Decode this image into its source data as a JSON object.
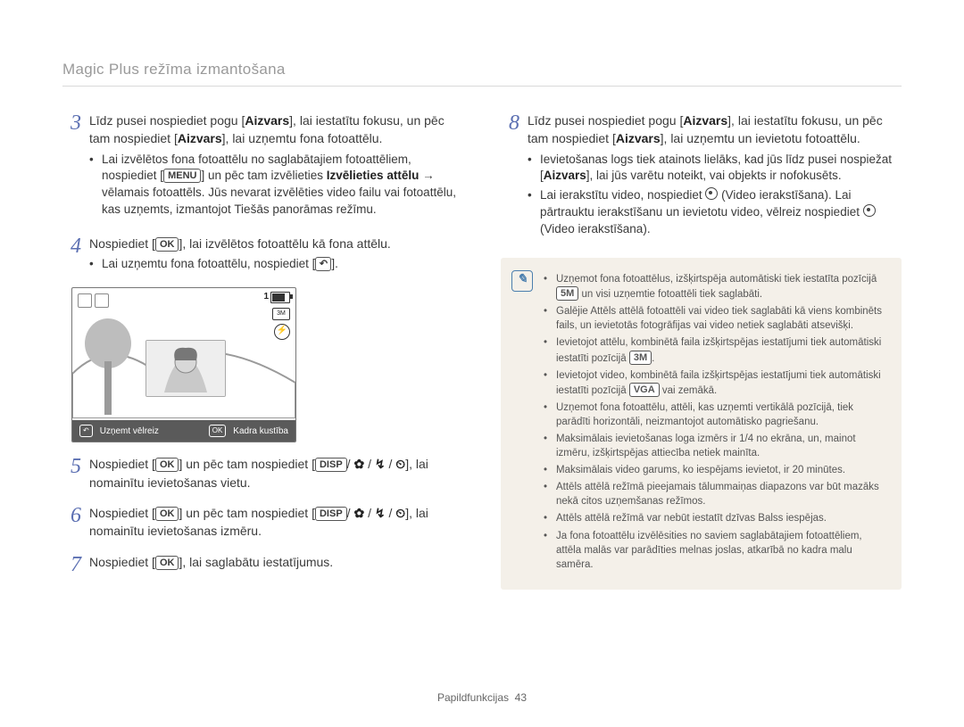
{
  "page_title": "Magic Plus režīma izmantošana",
  "footer": {
    "section": "Papildfunkcijas",
    "page": "43"
  },
  "left": {
    "steps": [
      {
        "n": "3",
        "text": [
          "Līdz pusei nospiediet pogu [<b>Aizvars</b>], lai iestatītu fokusu, un pēc tam nospiediet [<b>Aizvars</b>], lai uzņemtu fona fotoattēlu."
        ],
        "bullets": [
          "Lai izvēlētos fona fotoattēlu no saglabātajiem fotoattēliem, nospiediet [<span class='key'>MENU</span>] un pēc tam izvēlieties <b>Izvēlieties attēlu</b> → vēlamais fotoattēls. Jūs nevarat izvēlēties video failu vai fotoattēlu, kas uzņemts, izmantojot Tiešās panorāmas režīmu."
        ]
      },
      {
        "n": "4",
        "text": [
          "Nospiediet [<span class='key'>OK</span>], lai izvēlētos fotoattēlu kā fona attēlu."
        ],
        "bullets": [
          "Lai uzņemtu fona fotoattēlu, nospiediet [<span class='key icon'>↶</span>]."
        ],
        "has_screenshot": true
      },
      {
        "n": "5",
        "text": [
          "Nospiediet [<span class='key'>OK</span>] un pēc tam nospiediet [<span class='key'>DISP</span>/ <b>✿</b> / <b>↯</b> / <b>⏲</b>], lai nomainītu ievietošanas vietu."
        ]
      },
      {
        "n": "6",
        "text": [
          "Nospiediet [<span class='key'>OK</span>] un pēc tam nospiediet [<span class='key'>DISP</span>/ <b>✿</b> / <b>↯</b> / <b>⏲</b>], lai nomainītu ievietošanas izmēru."
        ]
      },
      {
        "n": "7",
        "text": [
          "Nospiediet [<span class='key'>OK</span>], lai saglabātu iestatījumus."
        ]
      }
    ],
    "screenshot": {
      "top_index": "1",
      "bottom_left": "Uzņemt vēlreiz",
      "bottom_right": "Kadra kustība"
    }
  },
  "right": {
    "steps": [
      {
        "n": "8",
        "text": [
          "Līdz pusei nospiediet pogu [<b>Aizvars</b>], lai iestatītu fokusu, un pēc tam nospiediet [<b>Aizvars</b>], lai uzņemtu un ievietotu fotoattēlu."
        ],
        "bullets": [
          "Ievietošanas logs tiek atainots lielāks, kad jūs līdz pusei nospiežat [<b>Aizvars</b>], lai jūs varētu noteikt, vai objekts ir nofokusēts.",
          "Lai ierakstītu video, nospiediet <span class='circ'></span> (Video ierakstīšana). Lai pārtrauktu ierakstīšanu un ievietotu video, vēlreiz nospiediet <span class='circ'></span> (Video ierakstīšana)."
        ]
      }
    ],
    "note_bullets": [
      "Uzņemot fona fotoattēlus, izšķirtspēja automātiski tiek iestatīta pozīcijā <span class='key'>5M</span> un visi uzņemtie fotoattēli tiek saglabāti.",
      "Galējie Attēls attēlā fotoattēli vai video tiek saglabāti kā viens kombinēts fails, un ievietotās fotogrāfijas vai video netiek saglabāti atsevišķi.",
      "Ievietojot attēlu, kombinētā faila izšķirtspējas iestatījumi tiek automātiski iestatīti pozīcijā <span class='key'>3M</span>.",
      "Ievietojot video, kombinētā faila izšķirtspējas iestatījumi tiek automātiski iestatīti pozīcijā <span class='key'>VGA</span> vai zemākā.",
      "Uzņemot fona fotoattēlu, attēli, kas uzņemti vertikālā pozīcijā, tiek parādīti horizontāli, neizmantojot automātisko pagriešanu.",
      "Maksimālais ievietošanas loga izmērs ir 1/4 no ekrāna, un, mainot izmēru, izšķirtspējas attiecība netiek mainīta.",
      "Maksimālais video garums, ko iespējams ievietot, ir 20 minūtes.",
      "Attēls attēlā režīmā pieejamais tālummaiņas diapazons var būt mazāks nekā citos uzņemšanas režīmos.",
      "Attēls attēlā režīmā var nebūt iestatīt dzīvas Balss iespējas.",
      "Ja fona fotoattēlu izvēlēsities no saviem saglabātajiem fotoattēliem, attēla malās var parādīties melnas joslas, atkarībā no kadra malu samēra."
    ]
  }
}
